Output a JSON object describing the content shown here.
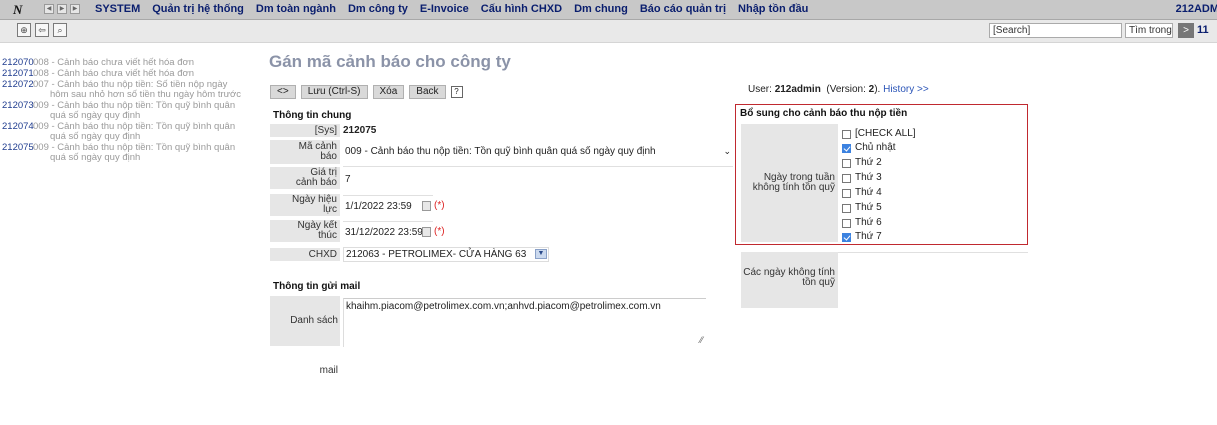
{
  "menubar": {
    "logo": "N",
    "items": [
      "SYSTEM",
      "Quản trị hệ thống",
      "Dm toàn ngành",
      "Dm công ty",
      "E-Invoice",
      "Cấu hình CHXD",
      "Dm chung",
      "Báo cáo quản trị",
      "Nhập tồn đầu"
    ],
    "account": "212ADM"
  },
  "toolbar": {
    "search_value": "[Search]",
    "scope_value": "Tìm trong",
    "go_label": ">",
    "page_number": "11"
  },
  "left_list": [
    {
      "code": "212070",
      "text": "008 - Cảnh báo chưa viết hết hóa đơn"
    },
    {
      "code": "212071",
      "text": "008 - Cảnh báo chưa viết hết hóa đơn"
    },
    {
      "code": "212072",
      "text": "007 - Cảnh báo thu nộp tiền: Số tiền nộp ngày",
      "text2": "hôm sau nhỏ hơn số tiền thu ngày hôm trước"
    },
    {
      "code": "212073",
      "text": "009 - Cảnh báo thu nộp tiền: Tồn quỹ bình quân",
      "text2": "quá số ngày quy định"
    },
    {
      "code": "212074",
      "text": "009 - Cảnh báo thu nộp tiền: Tồn quỹ bình quân",
      "text2": "quá số ngày quy định"
    },
    {
      "code": "212075",
      "text": "009 - Cảnh báo thu nộp tiền: Tồn quỹ bình quân",
      "text2": "quá số ngày quy định"
    }
  ],
  "page_title": "Gán mã cảnh báo cho công ty",
  "actions": {
    "toggle": "<>",
    "save": "Lưu (Ctrl-S)",
    "delete": "Xóa",
    "back": "Back",
    "help": "?"
  },
  "general": {
    "section_title": "Thông tin chung",
    "sys_label": "[Sys]",
    "sys_value": "212075",
    "code_label_1": "Mã cảnh",
    "code_label_2": "báo",
    "code_value": "009 - Cảnh báo thu nộp tiền: Tồn quỹ bình quân quá số ngày quy định",
    "value_label_1": "Giá trị",
    "value_label_2": "cảnh báo",
    "value_value": "7",
    "effective_label_1": "Ngày hiệu",
    "effective_label_2": "lực",
    "effective_value": "1/1/2022 23:59",
    "end_label_1": "Ngày kết",
    "end_label_2": "thúc",
    "end_value": "31/12/2022 23:59",
    "required_mark": "(*)",
    "chxd_label": "CHXD",
    "chxd_value": "212063 - PETROLIMEX- CỬA HÀNG 63"
  },
  "mail": {
    "section_title": "Thông tin gửi mail",
    "list_label": "Danh sách mail",
    "list_value": "khaihm.piacom@petrolimex.com.vn;anhvd.piacom@petrolimex.com.vn"
  },
  "user_info": {
    "prefix": "User:",
    "user": "212admin",
    "version_prefix": "(Version:",
    "version": "2",
    "version_suffix": ").",
    "history": "History >>"
  },
  "supplement": {
    "section_title": "Bổ sung cho cảnh báo thu nộp tiền",
    "weekdays_label_1": "Ngày trong tuần",
    "weekdays_label_2": "không tính tồn quỹ",
    "options": [
      {
        "label": "[CHECK ALL]",
        "checked": false
      },
      {
        "label": "Chủ nhật",
        "checked": true
      },
      {
        "label": "Thứ 2",
        "checked": false
      },
      {
        "label": "Thứ 3",
        "checked": false
      },
      {
        "label": "Thứ 4",
        "checked": false
      },
      {
        "label": "Thứ 5",
        "checked": false
      },
      {
        "label": "Thứ 6",
        "checked": false
      },
      {
        "label": "Thứ 7",
        "checked": true
      }
    ],
    "excluded_days_label_1": "Các ngày không tính",
    "excluded_days_label_2": "tồn quỹ"
  },
  "colors": {
    "menu_text": "#0a1e6e",
    "highlight_border": "#c0292f",
    "checkbox_on": "#3c82e0",
    "list_code": "#1f3c8f"
  }
}
